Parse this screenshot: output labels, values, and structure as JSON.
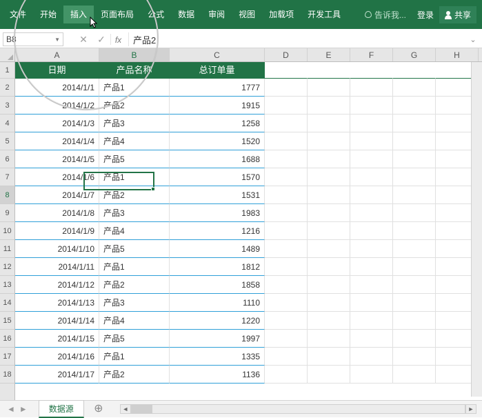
{
  "ribbon": {
    "file": "文件",
    "tabs": [
      "开始",
      "插入",
      "页面布局",
      "公式",
      "数据",
      "审阅",
      "视图",
      "加载项",
      "开发工具"
    ],
    "active_tab_index": 1,
    "tell_me": "告诉我...",
    "login": "登录",
    "share": "共享"
  },
  "namebox": {
    "value": "B8"
  },
  "formula_bar": {
    "fx": "fx",
    "value": "产品2"
  },
  "columns": [
    "A",
    "B",
    "C",
    "D",
    "E",
    "F",
    "G",
    "H"
  ],
  "selected_col_index": 1,
  "row_numbers": [
    1,
    2,
    3,
    4,
    5,
    6,
    7,
    8,
    9,
    10,
    11,
    12,
    13,
    14,
    15,
    16,
    17,
    18
  ],
  "selected_row_index": 7,
  "headers": {
    "A": "日期",
    "B": "产品名称",
    "C": "总订单量"
  },
  "rows": [
    {
      "A": "2014/1/1",
      "B": "产品1",
      "C": "1777"
    },
    {
      "A": "2014/1/2",
      "B": "产品2",
      "C": "1915"
    },
    {
      "A": "2014/1/3",
      "B": "产品3",
      "C": "1258"
    },
    {
      "A": "2014/1/4",
      "B": "产品4",
      "C": "1520"
    },
    {
      "A": "2014/1/5",
      "B": "产品5",
      "C": "1688"
    },
    {
      "A": "2014/1/6",
      "B": "产品1",
      "C": "1570"
    },
    {
      "A": "2014/1/7",
      "B": "产品2",
      "C": "1531"
    },
    {
      "A": "2014/1/8",
      "B": "产品3",
      "C": "1983"
    },
    {
      "A": "2014/1/9",
      "B": "产品4",
      "C": "1216"
    },
    {
      "A": "2014/1/10",
      "B": "产品5",
      "C": "1489"
    },
    {
      "A": "2014/1/11",
      "B": "产品1",
      "C": "1812"
    },
    {
      "A": "2014/1/12",
      "B": "产品2",
      "C": "1858"
    },
    {
      "A": "2014/1/13",
      "B": "产品3",
      "C": "1110"
    },
    {
      "A": "2014/1/14",
      "B": "产品4",
      "C": "1220"
    },
    {
      "A": "2014/1/15",
      "B": "产品5",
      "C": "1997"
    },
    {
      "A": "2014/1/16",
      "B": "产品1",
      "C": "1335"
    },
    {
      "A": "2014/1/17",
      "B": "产品2",
      "C": "1136"
    }
  ],
  "active_cell": {
    "ref": "B8",
    "col": 1,
    "row": 7
  },
  "sheet_tab": "数据源"
}
